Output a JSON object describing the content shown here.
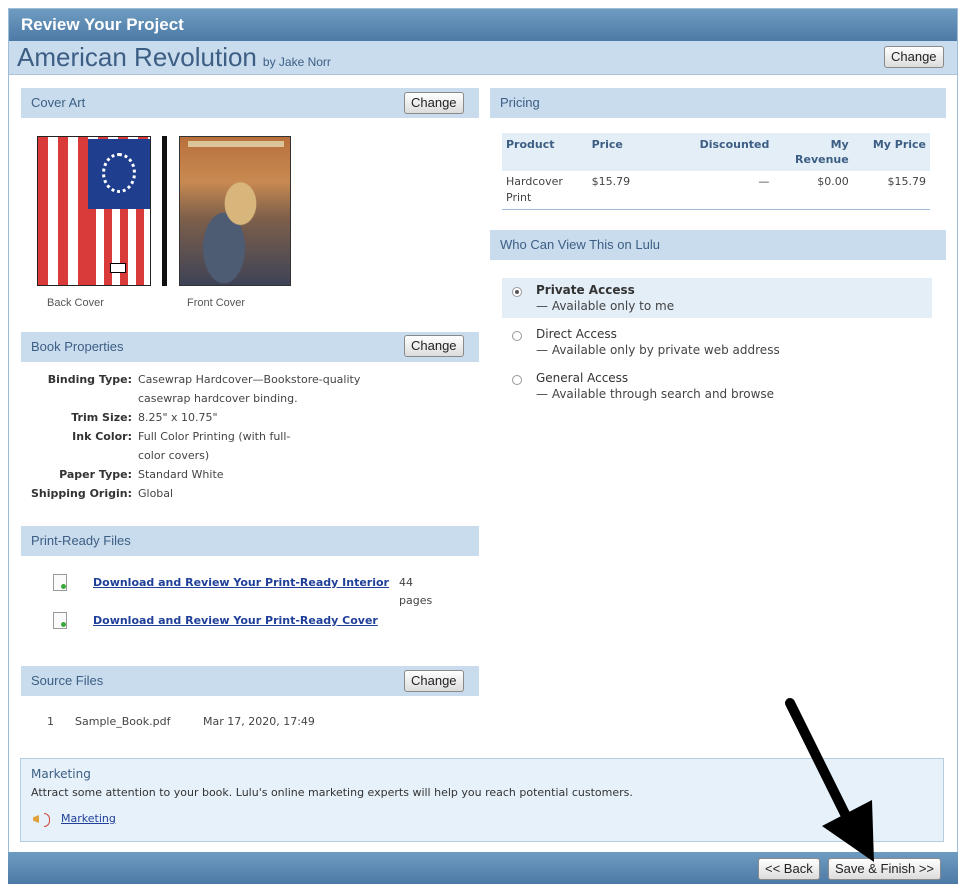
{
  "header": {
    "window_title": "Review Your Project",
    "project_title": "American Revolution",
    "author_line": "by Jake Norr",
    "change_label": "Change"
  },
  "cover_art": {
    "section_title": "Cover Art",
    "change_label": "Change",
    "back_caption": "Back Cover",
    "front_caption": "Front Cover"
  },
  "book_properties": {
    "section_title": "Book Properties",
    "change_label": "Change",
    "rows": [
      {
        "label": "Binding Type:",
        "value": "Casewrap Hardcover—Bookstore-quality casewrap hardcover binding."
      },
      {
        "label": "Trim Size:",
        "value": "8.25\" x 10.75\""
      },
      {
        "label": "Ink Color:",
        "value": "Full Color Printing (with full-color covers)"
      },
      {
        "label": "Paper Type:",
        "value": "Standard White"
      },
      {
        "label": "Shipping Origin:",
        "value": "Global"
      }
    ]
  },
  "print_ready": {
    "section_title": "Print-Ready Files",
    "files": [
      {
        "link": "Download and Review Your Print-Ready Interior",
        "pages": "44 pages"
      },
      {
        "link": "Download and Review Your Print-Ready Cover",
        "pages": ""
      }
    ]
  },
  "source_files": {
    "section_title": "Source Files",
    "change_label": "Change",
    "rows": [
      {
        "index": "1",
        "name": "Sample_Book.pdf",
        "date": "Mar 17, 2020, 17:49"
      }
    ]
  },
  "pricing": {
    "section_title": "Pricing",
    "columns": [
      "Product",
      "Price",
      "Discounted",
      "My Revenue",
      "My Price"
    ],
    "rows": [
      {
        "product": "Hardcover Print",
        "price": "$15.79",
        "discounted": "—",
        "revenue": "$0.00",
        "my_price": "$15.79"
      }
    ]
  },
  "access": {
    "section_title": "Who Can View This on Lulu",
    "options": [
      {
        "title": "Private Access",
        "desc": "— Available only to me",
        "selected": true
      },
      {
        "title": "Direct Access",
        "desc": "— Available only by private web address",
        "selected": false
      },
      {
        "title": "General Access",
        "desc": "— Available through search and browse",
        "selected": false
      }
    ]
  },
  "marketing": {
    "title": "Marketing",
    "text": "Attract some attention to your book. Lulu's online marketing experts will help you reach potential customers.",
    "link": "Marketing"
  },
  "footer": {
    "back_label": "<< Back",
    "finish_label": "Save & Finish >>"
  },
  "icons": {
    "file": "file-icon",
    "megaphone": "megaphone-icon",
    "annotation_arrow": "arrow-icon"
  }
}
